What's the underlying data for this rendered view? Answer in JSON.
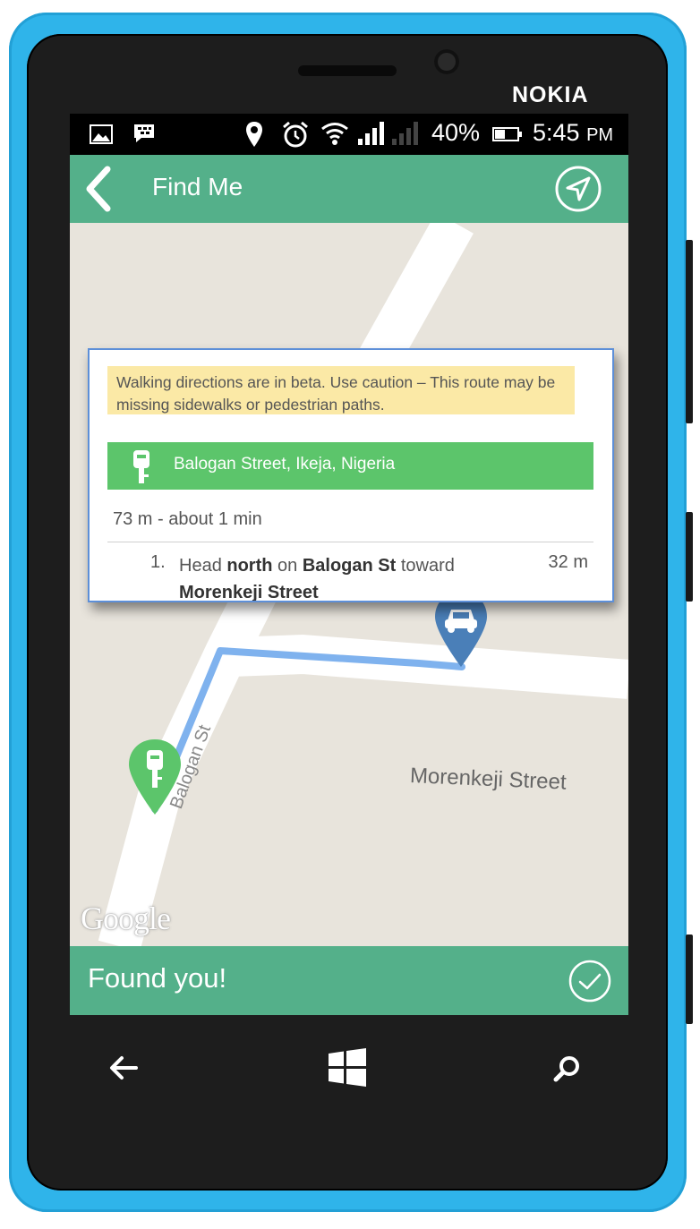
{
  "device": {
    "brand": "NOKIA"
  },
  "status_bar": {
    "battery_percent": "40%",
    "time": "5:45",
    "time_suffix": "PM"
  },
  "app_bar": {
    "title": "Find Me"
  },
  "directions": {
    "warning": "Walking directions are in beta. Use caution – This route may be missing sidewalks or pedestrian paths.",
    "destination": "Balogan Street, Ikeja, Nigeria",
    "summary": "73 m - about 1 min",
    "steps": [
      {
        "number": "1.",
        "pre": "Head ",
        "dir": "north",
        "mid": " on ",
        "road": "Balogan St",
        "post": " toward ",
        "toward": "Morenkeji Street",
        "distance": "32 m"
      }
    ]
  },
  "map": {
    "street_labels": [
      "Morenkeji Street",
      "Balogan St"
    ],
    "attribution": "Google",
    "markers": [
      {
        "name": "destination",
        "icon": "parking-key-icon",
        "color": "#5cc56b"
      },
      {
        "name": "car",
        "icon": "car-icon",
        "color": "#4a7fb8"
      }
    ]
  },
  "bottom_bar": {
    "message": "Found you!"
  },
  "colors": {
    "phone_body": "#2fb4ea",
    "app_green": "#54b08a",
    "destination_green": "#5cc56b",
    "route_blue": "#7fb2ee",
    "warning_yellow": "#fbe9a6"
  }
}
